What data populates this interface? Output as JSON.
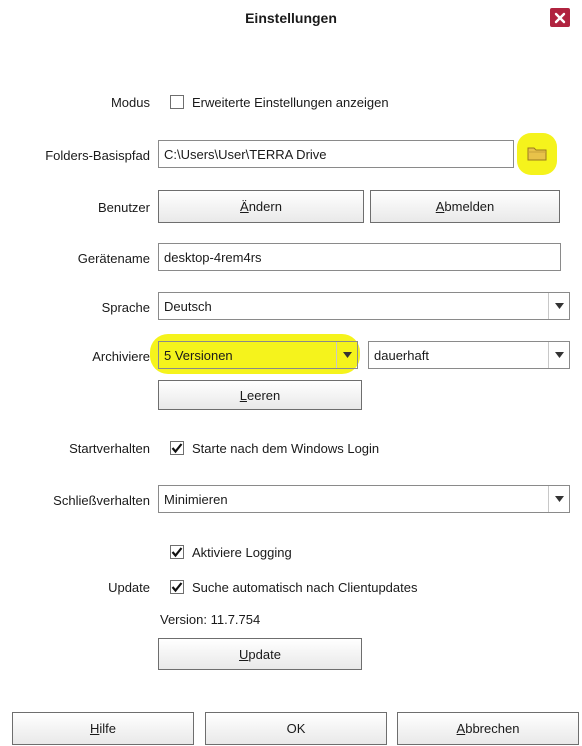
{
  "dialog": {
    "title": "Einstellungen"
  },
  "modus": {
    "label": "Modus",
    "checkbox_label": "Erweiterte Einstellungen anzeigen",
    "checked": false
  },
  "folders": {
    "label": "Folders-Basispfad",
    "value": "C:\\Users\\User\\TERRA Drive"
  },
  "benutzer": {
    "label": "Benutzer",
    "change_pre": "Ä",
    "change_post": "ndern",
    "logout_pre": "A",
    "logout_post": "bmelden"
  },
  "geraetename": {
    "label": "Gerätename",
    "value": "desktop-4rem4rs"
  },
  "sprache": {
    "label": "Sprache",
    "value": "Deutsch"
  },
  "archiviere": {
    "label": "Archiviere",
    "versions": "5 Versionen",
    "duration": "dauerhaft",
    "clear_pre": "L",
    "clear_post": "eeren",
    "highlight_color": "#f5f31c"
  },
  "start": {
    "label": "Startverhalten",
    "checkbox_label": "Starte nach dem Windows Login",
    "checked": true
  },
  "schliess": {
    "label": "Schließverhalten",
    "value": "Minimieren"
  },
  "logging": {
    "checkbox_label": "Aktiviere Logging",
    "checked": true
  },
  "update": {
    "label": "Update",
    "checkbox_label": "Suche automatisch nach Clientupdates",
    "checked": true,
    "version_text": "Version: 11.7.754",
    "button_pre": "U",
    "button_post": "pdate"
  },
  "footer": {
    "help_pre": "H",
    "help_post": "ilfe",
    "ok": "OK",
    "cancel_pre": "A",
    "cancel_post": "bbrechen"
  },
  "colors": {
    "close": "#b0233f",
    "highlight": "#f5f31c"
  }
}
